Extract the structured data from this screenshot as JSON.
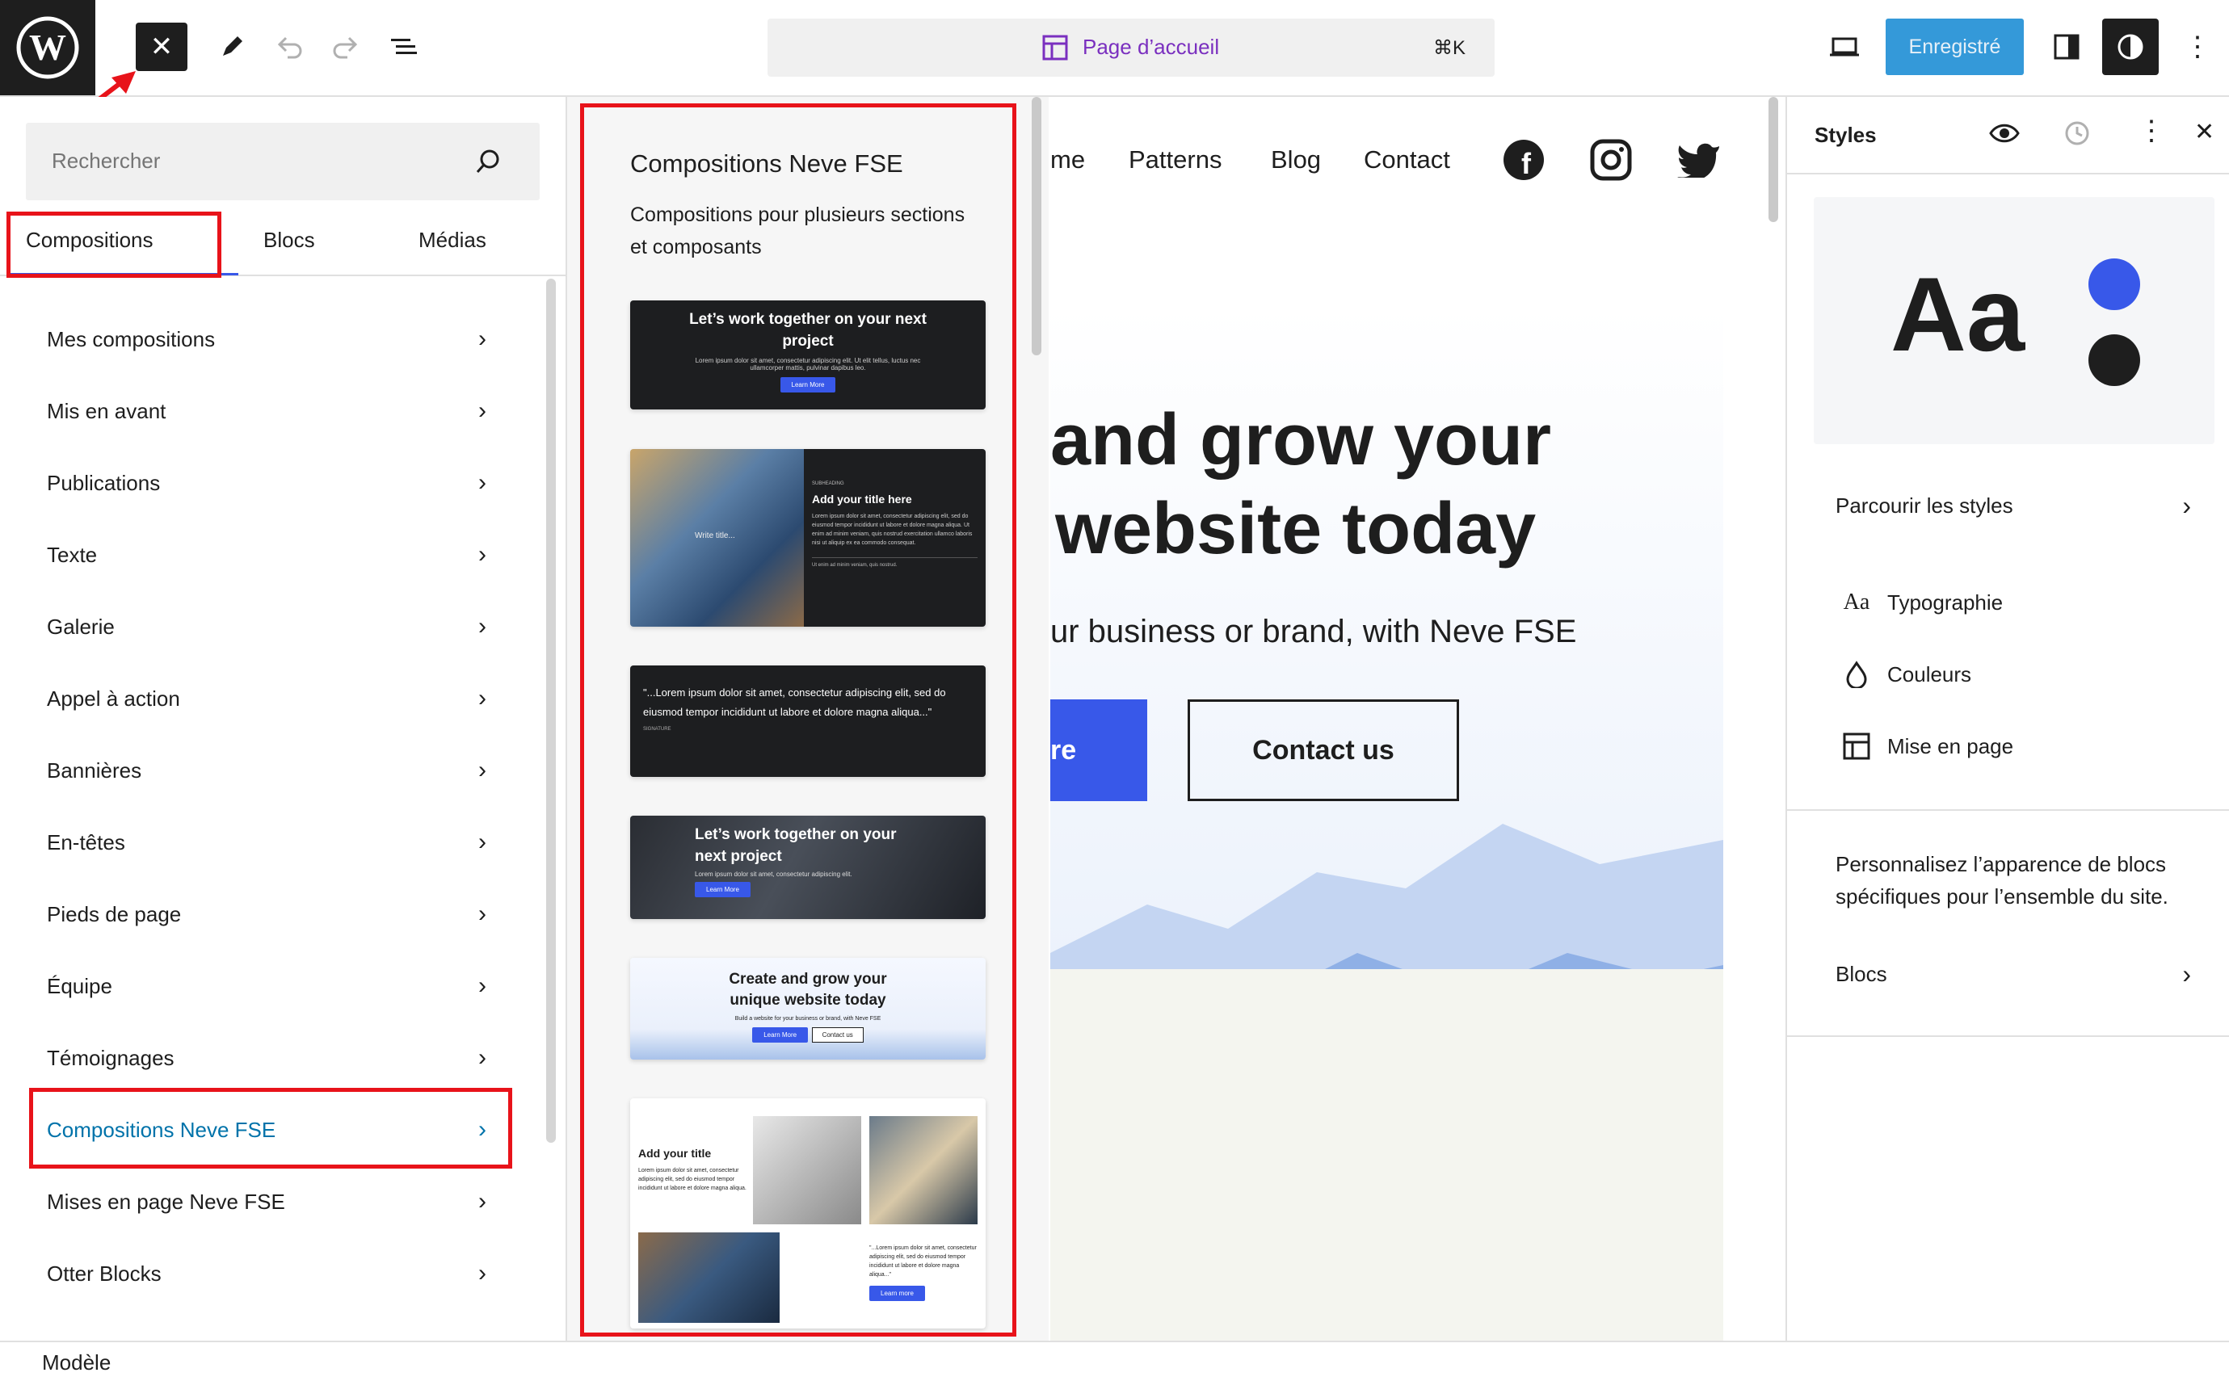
{
  "topbar": {
    "command_label": "Page d’accueil",
    "command_shortcut": "⌘K",
    "save_label": "Enregistré"
  },
  "left_panel": {
    "search_placeholder": "Rechercher",
    "tabs": [
      {
        "label": "Compositions"
      },
      {
        "label": "Blocs"
      },
      {
        "label": "Médias"
      }
    ],
    "categories": [
      {
        "label": "Mes compositions"
      },
      {
        "label": "Mis en avant"
      },
      {
        "label": "Publications"
      },
      {
        "label": "Texte"
      },
      {
        "label": "Galerie"
      },
      {
        "label": "Appel à action"
      },
      {
        "label": "Bannières"
      },
      {
        "label": "En-têtes"
      },
      {
        "label": "Pieds de page"
      },
      {
        "label": "Équipe"
      },
      {
        "label": "Témoignages"
      },
      {
        "label": "Compositions Neve FSE"
      },
      {
        "label": "Mises en page Neve FSE"
      },
      {
        "label": "Otter Blocks"
      }
    ],
    "active_category_color": "#0073aa"
  },
  "patterns": {
    "title": "Compositions Neve FSE",
    "description": "Compositions pour plusieurs sections et composants",
    "p1_title": "Let’s work together on your next project",
    "p1_text": "Lorem ipsum dolor sit amet, consectetur adipiscing elit. Ut elit tellus, luctus nec ullamcorper mattis, pulvinar dapibus leo.",
    "p1_btn": "Learn More",
    "p2_overlay": "Write title...",
    "p2_kicker": "SUBHEADING",
    "p2_title": "Add your title here",
    "p2_text": "Lorem ipsum dolor sit amet, consectetur adipiscing elit, sed do eiusmod tempor incididunt ut labore et dolore magna aliqua. Ut enim ad minim veniam, quis nostrud exercitation ullamco laboris nisi ut aliquip ex ea commodo consequat.",
    "p2_col": "Ut enim ad minim veniam, quis nostrud.",
    "p3_quote": "\"...Lorem ipsum dolor sit amet, consectetur adipiscing elit, sed do eiusmod tempor incididunt ut labore et dolore magna aliqua...\"",
    "p3_author": "SIGNATURE",
    "p4_title": "Let’s work together on your next project",
    "p4_text": "Lorem ipsum dolor sit amet, consectetur adipiscing elit.",
    "p4_btn": "Learn More",
    "p5_title": "Create and grow your unique website today",
    "p5_text": "Build a website for your business or brand, with Neve FSE",
    "p5_btn1": "Learn More",
    "p5_btn2": "Contact us",
    "p6_title": "Add your title",
    "p6_text": "Lorem ipsum dolor sit amet, consectetur adipiscing elit, sed do eiusmod tempor incididunt ut labore et dolore magna aliqua.",
    "p6_quote": "\"...Lorem ipsum dolor sit amet, consectetur adipiscing elit, sed do eiusmod tempor incididunt ut labore et dolore magna aliqua...\"",
    "p6_btn": "Learn more"
  },
  "canvas": {
    "nav_home": "me",
    "nav_patterns": "Patterns",
    "nav_blog": "Blog",
    "nav_contact": "Contact",
    "hero_line1": "and grow your",
    "hero_line2": "website today",
    "hero_sub": "ur business or brand, with Neve FSE",
    "learn_btn": "re",
    "contact_btn": "Contact us",
    "accent": "#3858e9"
  },
  "styles_panel": {
    "title": "Styles",
    "preview_text": "Aa",
    "browse_label": "Parcourir les styles",
    "typography_label": "Typographie",
    "colors_label": "Couleurs",
    "layout_label": "Mise en page",
    "description": "Personnalisez l’apparence de blocs spécifiques pour l’ensemble du site.",
    "blocks_label": "Blocs",
    "dot_colors": [
      "#3858e9",
      "#1e1e1e"
    ]
  },
  "bottombar": {
    "label": "Modèle"
  }
}
